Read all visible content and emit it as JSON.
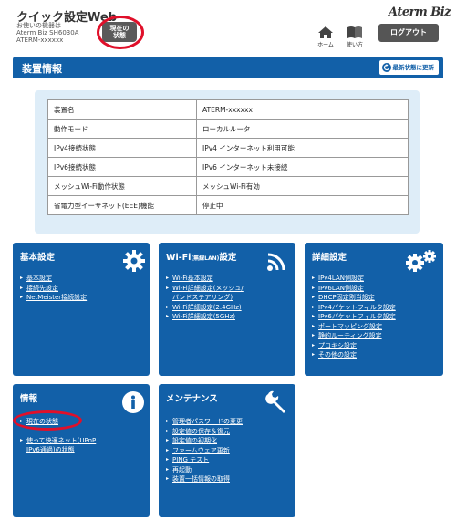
{
  "header": {
    "app_title": "クイック設定Web",
    "device_line1": "お使いの機器は",
    "device_line2": "Aterm Biz SH6030A",
    "device_line3": "ATERM-xxxxxx",
    "status_button_line1": "現在の",
    "status_button_line2": "状態",
    "brand": "Aterm Biz",
    "home_label": "ホーム",
    "help_label": "使い方",
    "logout_label": "ログアウト"
  },
  "device_info": {
    "title": "装置情報",
    "refresh_label": "最新状態に更新",
    "rows": [
      {
        "key": "装置名",
        "value": "ATERM-xxxxxx"
      },
      {
        "key": "動作モード",
        "value": "ローカルルータ"
      },
      {
        "key": "IPv4接続状態",
        "value": "IPv4 インターネット利用可能"
      },
      {
        "key": "IPv6接続状態",
        "value": "IPv6 インターネット未接続"
      },
      {
        "key": "メッシュWi-Fi動作状態",
        "value": "メッシュWi-Fi有効"
      },
      {
        "key": "省電力型イーサネット(EEE)機能",
        "value": "停止中"
      }
    ]
  },
  "tiles": {
    "basic": {
      "title": "基本設定",
      "items": [
        "基本設定",
        "接続先設定",
        "NetMeister接続設定"
      ]
    },
    "wifi": {
      "title_main": "Wi-Fi",
      "title_small": "(無線LAN)",
      "title_tail": "設定",
      "items": [
        "Wi-Fi基本設定",
        "Wi-Fi詳細設定(メッシュ/",
        "バンドステアリング)",
        "Wi-Fi詳細設定(2.4GHz)",
        "Wi-Fi詳細設定(5GHz)"
      ]
    },
    "advanced": {
      "title": "詳細設定",
      "items": [
        "IPv4LAN側設定",
        "IPv6LAN側設定",
        "DHCP固定割当設定",
        "IPv4パケットフィルタ設定",
        "IPv6パケットフィルタ設定",
        "ポートマッピング設定",
        "静的ルーティング設定",
        "プロキシ設定",
        "その他の設定"
      ]
    },
    "info": {
      "title": "情報",
      "items": [
        "現在の状態",
        "使って快適ネット(UPnP",
        "IPv6通過)の状態"
      ]
    },
    "maintenance": {
      "title": "メンテナンス",
      "items": [
        "管理者パスワードの変更",
        "設定値の保存＆復元",
        "設定値の初期化",
        "ファームウェア更新",
        "PING テスト",
        "再起動",
        "装置一括情報の取得"
      ]
    }
  },
  "colors": {
    "primary_blue": "#1260a8",
    "panel_bg": "#deedf8",
    "highlight_red": "#e0102a"
  }
}
